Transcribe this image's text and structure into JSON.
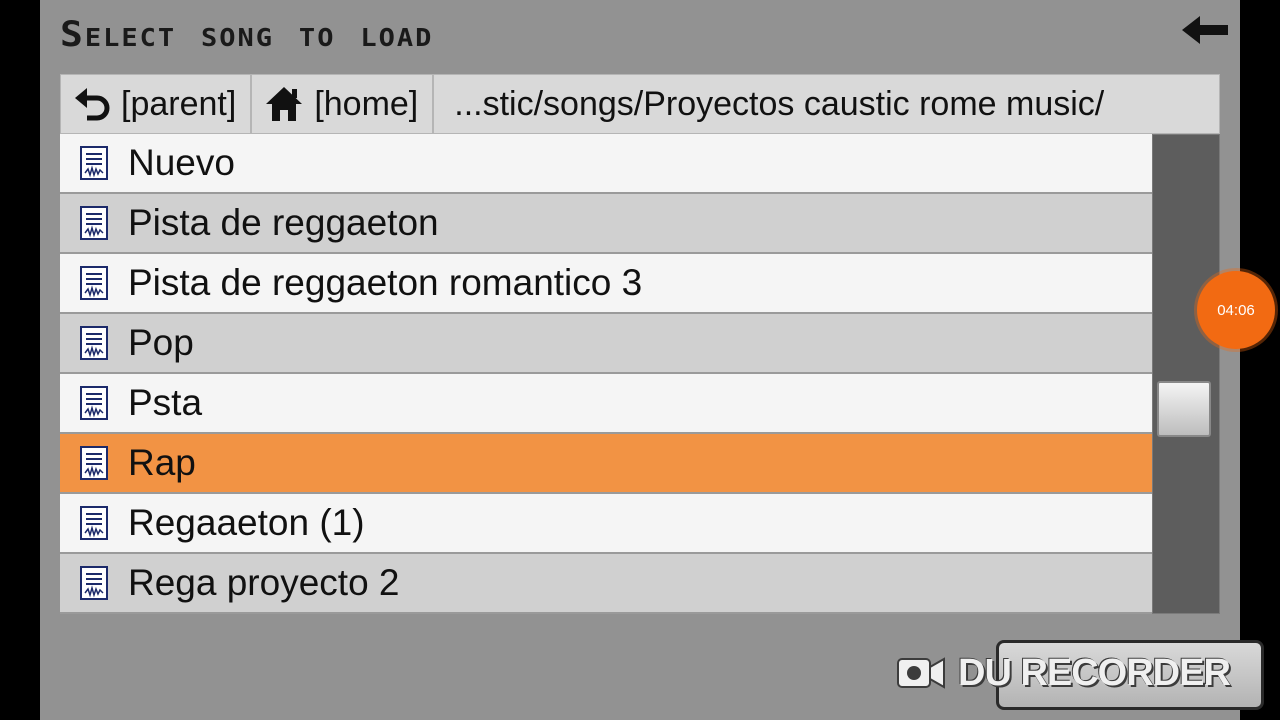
{
  "dialog": {
    "title": "Select song to load"
  },
  "pathbar": {
    "parent_label": "[parent]",
    "home_label": "[home]",
    "current_path": "...stic/songs/Proyectos caustic rome music/"
  },
  "files": [
    {
      "name": "Nuevo",
      "selected": false
    },
    {
      "name": "Pista de reggaeton",
      "selected": false
    },
    {
      "name": "Pista de reggaeton romantico 3",
      "selected": false
    },
    {
      "name": "Pop",
      "selected": false
    },
    {
      "name": "Psta",
      "selected": false
    },
    {
      "name": "Rap",
      "selected": true
    },
    {
      "name": "Regaaeton (1)",
      "selected": false
    },
    {
      "name": "Rega proyecto 2",
      "selected": false
    }
  ],
  "recorder": {
    "timer": "04:06",
    "watermark": "DU RECORDER"
  },
  "colors": {
    "selected_row": "#f29344",
    "dialog_bg": "#929292",
    "timer_bg": "#f26a12"
  }
}
